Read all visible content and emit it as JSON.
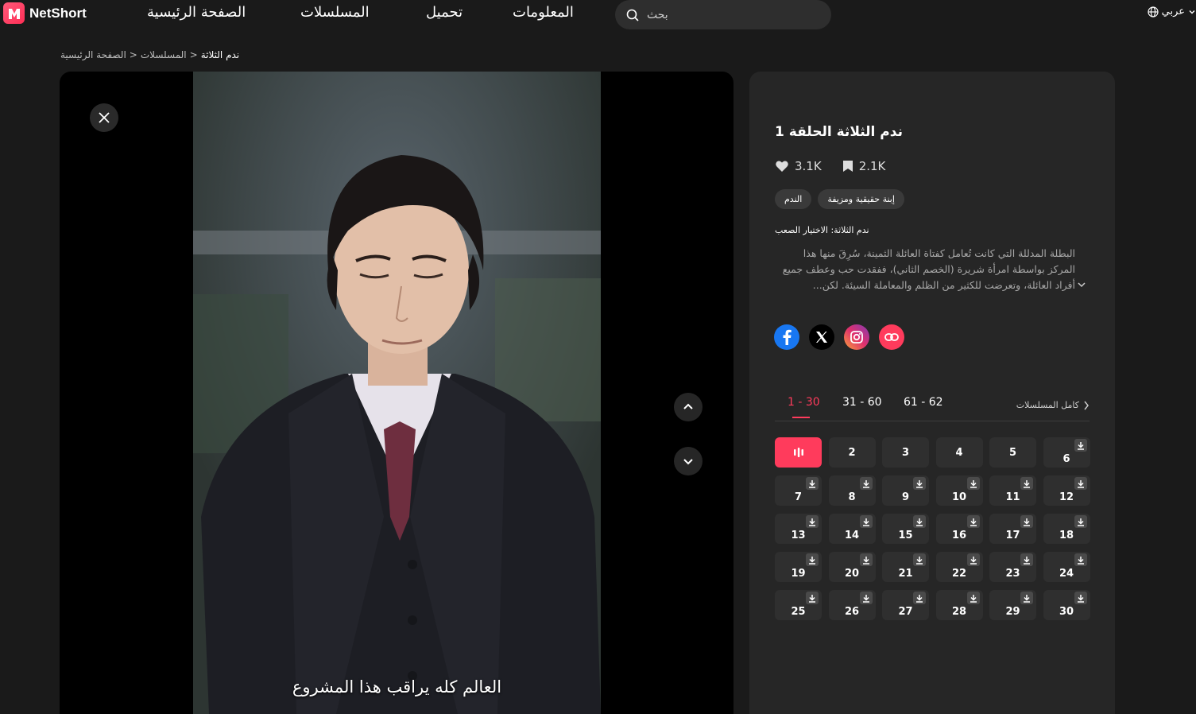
{
  "header": {
    "logo_text": "NetShort",
    "nav": [
      "الصفحة الرئيسية",
      "المسلسلات",
      "تحميل",
      "المعلومات"
    ],
    "search_placeholder": "بحث",
    "language": "عربي"
  },
  "breadcrumb": {
    "home": "الصفحة الرئيسية",
    "sep1": ">",
    "series": "المسلسلات",
    "sep2": ">",
    "current": "ندم الثلاثة"
  },
  "player": {
    "subtitle": "العالم كله يراقب هذا المشروع"
  },
  "info": {
    "episode_title": "ندم الثلاثة الحلقة 1",
    "likes": "3.1K",
    "saves": "2.1K",
    "tags": [
      "إبنة حقيقية ومزيفة",
      "الندم"
    ],
    "series_name": "ندم الثلاثة: الاختيار الصعب",
    "description": "البطلة المدللة التي كانت تُعامل كفتاة العائلة الثمينة، سُرِقَ منها هذا المركز بواسطة امرأة شريرة (الخصم الثاني)، ففقدت حب وعطف جميع أفراد العائلة، وتعرضت للكثير من الظلم والمعاملة السيئة. لكن..."
  },
  "socials": [
    "facebook-icon",
    "x-icon",
    "instagram-icon",
    "link-icon"
  ],
  "ranges": {
    "tabs": [
      "1 - 30",
      "31 - 60",
      "61 - 62"
    ],
    "active": 0,
    "all_series": "كامل المسلسلات"
  },
  "episodes": {
    "active": 1,
    "list": [
      1,
      2,
      3,
      4,
      5,
      6,
      7,
      8,
      9,
      10,
      11,
      12,
      13,
      14,
      15,
      16,
      17,
      18,
      19,
      20,
      21,
      22,
      23,
      24,
      25,
      26,
      27,
      28,
      29,
      30
    ]
  },
  "colors": {
    "accent": "#ff3b5c",
    "background": "#1a1a1a",
    "panel": "#262626"
  }
}
